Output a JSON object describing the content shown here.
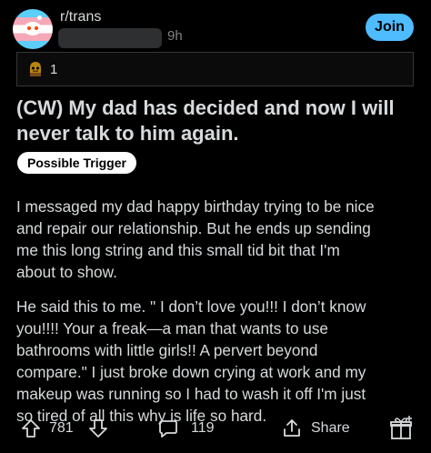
{
  "header": {
    "subreddit": "r/trans",
    "time": "9h",
    "join_label": "Join"
  },
  "awards": {
    "count": "1"
  },
  "post": {
    "title": "(CW) My dad has decided and now I will never talk to him again.",
    "flair": "Possible Trigger",
    "paragraphs": [
      [
        "I messaged my dad happy birthday trying to be nice",
        "and repair our relationship. But he ends up sending",
        "me this long string and this small tid bit that I'm",
        "about to show."
      ],
      [
        "He said this to me. \" I don’t love you!!! I don’t know",
        "you!!!! Your a freak—a man that wants to use",
        "bathrooms with little girls!! A pervert beyond",
        "compare.\" I just broke down crying at work and my",
        "makeup was running so I had to wash it off I'm just",
        "so tired of all this why is life so hard."
      ]
    ]
  },
  "actions": {
    "upvotes": "781",
    "comments": "119",
    "share_label": "Share"
  },
  "colors": {
    "background": "#000000",
    "text": "#d7dadc",
    "join_button": "#4fbcff",
    "meta": "#818384"
  },
  "icons": [
    "subreddit-avatar-icon",
    "award-icon",
    "upvote-icon",
    "downvote-icon",
    "comment-icon",
    "share-icon",
    "give-award-icon"
  ]
}
